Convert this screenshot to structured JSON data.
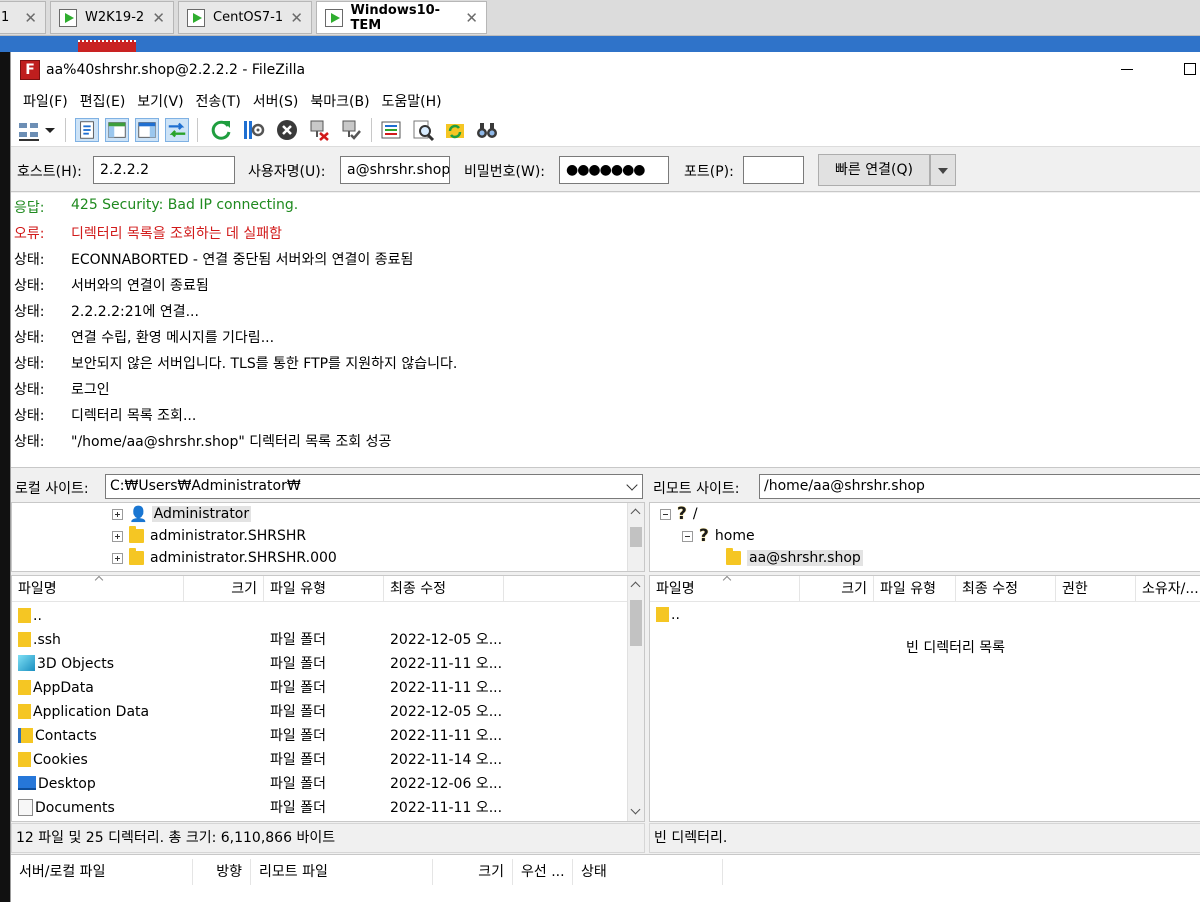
{
  "vm_tabs": [
    {
      "label": "1",
      "active": false
    },
    {
      "label": "W2K19-2",
      "active": false
    },
    {
      "label": "CentOS7-1",
      "active": false
    },
    {
      "label": "Windows10-TEM",
      "active": true
    }
  ],
  "window": {
    "title": "aa%40shrshr.shop@2.2.2.2 - FileZilla",
    "logo": "F"
  },
  "menu": [
    "파일(F)",
    "편집(E)",
    "보기(V)",
    "전송(T)",
    "서버(S)",
    "북마크(B)",
    "도움말(H)"
  ],
  "toolbar_icons": [
    "site-manager-icon",
    "dropdown-arrow-icon",
    "toggle-message-log-icon",
    "toggle-local-tree-icon",
    "toggle-remote-tree-icon",
    "toggle-transfer-queue-icon",
    "refresh-icon",
    "process-queue-icon",
    "cancel-icon",
    "disconnect-icon",
    "reconnect-icon",
    "directory-filter-icon",
    "search-icon",
    "sync-browse-icon",
    "compare-icon"
  ],
  "quickconnect": {
    "host_label": "호스트(H):",
    "host_value": "2.2.2.2",
    "user_label": "사용자명(U):",
    "user_value": "a@shrshr.shop",
    "pass_label": "비밀번호(W):",
    "pass_value": "●●●●●●●",
    "port_label": "포트(P):",
    "port_value": "",
    "connect_button": "빠른 연결(Q)"
  },
  "log": [
    {
      "label": "응답:",
      "text": "425 Security: Bad IP connecting.",
      "kind": "ok"
    },
    {
      "label": "오류:",
      "text": "디렉터리 목록을 조회하는 데 실패함",
      "kind": "err"
    },
    {
      "label": "상태:",
      "text": "ECONNABORTED - 연결 중단됨 서버와의 연결이 종료됨",
      "kind": "status"
    },
    {
      "label": "상태:",
      "text": "서버와의 연결이 종료됨",
      "kind": "status"
    },
    {
      "label": "상태:",
      "text": "2.2.2.2:21에 연결...",
      "kind": "status"
    },
    {
      "label": "상태:",
      "text": "연결 수립, 환영 메시지를 기다림...",
      "kind": "status"
    },
    {
      "label": "상태:",
      "text": "보안되지 않은 서버입니다. TLS를 통한 FTP를 지원하지 않습니다.",
      "kind": "status"
    },
    {
      "label": "상태:",
      "text": "로그인",
      "kind": "status"
    },
    {
      "label": "상태:",
      "text": "디렉터리 목록 조회...",
      "kind": "status"
    },
    {
      "label": "상태:",
      "text": "\"/home/aa@shrshr.shop\" 디렉터리 목록 조회 성공",
      "kind": "status"
    }
  ],
  "local": {
    "site_label": "로컬 사이트:",
    "path": "C:₩Users₩Administrator₩",
    "tree": [
      "Administrator",
      "administrator.SHRSHR",
      "administrator.SHRSHR.000"
    ],
    "columns": [
      "파일명",
      "크기",
      "파일 유형",
      "최종 수정"
    ],
    "files": [
      {
        "name": "..",
        "type": "",
        "date": "",
        "icon": "folder-icon"
      },
      {
        "name": ".ssh",
        "type": "파일 폴더",
        "date": "2022-12-05 오...",
        "icon": "folder-icon"
      },
      {
        "name": "3D Objects",
        "type": "파일 폴더",
        "date": "2022-11-11 오...",
        "icon": "3d-objects-icon"
      },
      {
        "name": "AppData",
        "type": "파일 폴더",
        "date": "2022-11-11 오...",
        "icon": "folder-icon"
      },
      {
        "name": "Application Data",
        "type": "파일 폴더",
        "date": "2022-12-05 오...",
        "icon": "folder-icon"
      },
      {
        "name": "Contacts",
        "type": "파일 폴더",
        "date": "2022-11-11 오...",
        "icon": "contacts-icon"
      },
      {
        "name": "Cookies",
        "type": "파일 폴더",
        "date": "2022-11-14 오...",
        "icon": "folder-icon"
      },
      {
        "name": "Desktop",
        "type": "파일 폴더",
        "date": "2022-12-06 오...",
        "icon": "desktop-icon"
      },
      {
        "name": "Documents",
        "type": "파일 폴더",
        "date": "2022-11-11 오...",
        "icon": "documents-icon"
      }
    ],
    "status": "12 파일 및 25 디렉터리. 총 크기: 6,110,866 바이트"
  },
  "remote": {
    "site_label": "리모트 사이트:",
    "path": "/home/aa@shrshr.shop",
    "tree": [
      "/",
      "home",
      "aa@shrshr.shop"
    ],
    "columns": [
      "파일명",
      "크기",
      "파일 유형",
      "최종 수정",
      "권한",
      "소유자/..."
    ],
    "files": [
      {
        "name": ".."
      }
    ],
    "empty_message": "빈 디렉터리 목록",
    "status": "빈 디렉터리."
  },
  "queue_columns": [
    "서버/로컬 파일",
    "방향",
    "리모트 파일",
    "크기",
    "우선 ...",
    "상태"
  ],
  "colors": {
    "ok": "#1f8a1f",
    "error": "#d11a1a",
    "folder": "#f5c623",
    "accent": "#2f73c9"
  }
}
